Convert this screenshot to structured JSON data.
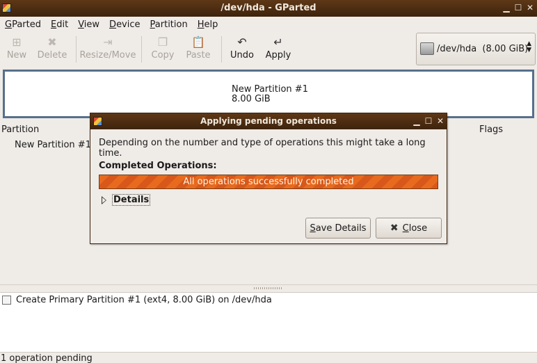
{
  "window": {
    "title": "/dev/hda - GParted"
  },
  "menu": [
    {
      "ul": "G",
      "rest": "Parted"
    },
    {
      "ul": "E",
      "rest": "dit"
    },
    {
      "ul": "V",
      "rest": "iew"
    },
    {
      "ul": "D",
      "rest": "evice"
    },
    {
      "ul": "P",
      "rest": "artition"
    },
    {
      "ul": "H",
      "rest": "elp"
    }
  ],
  "toolbar": {
    "new": "New",
    "delete": "Delete",
    "resize_move": "Resize/Move",
    "copy": "Copy",
    "paste": "Paste",
    "undo": "Undo",
    "apply": "Apply"
  },
  "device": {
    "label": "/dev/hda  (8.00 GiB)"
  },
  "graph": {
    "name": "New Partition #1",
    "size": "8.00 GiB"
  },
  "list": {
    "headers": {
      "partition": "Partition",
      "flags": "Flags"
    },
    "rows": [
      {
        "partition": "New Partition #1"
      }
    ]
  },
  "operations": [
    "Create Primary Partition #1 (ext4, 8.00 GiB) on /dev/hda"
  ],
  "status": "1 operation pending",
  "dialog": {
    "title": "Applying pending operations",
    "message": "Depending on the number and type of operations this might take a long time.",
    "completed_label": "Completed Operations:",
    "progress": {
      "text": "All operations successfully completed",
      "fraction": 1.0
    },
    "details_label": "Details",
    "save_details": {
      "ul": "S",
      "rest": "ave Details"
    },
    "close": {
      "ul": "C",
      "rest": "lose"
    }
  },
  "colors": {
    "titlebar": "#4e2d12",
    "progress": "#e86a1e",
    "graph_border": "#56708c"
  }
}
